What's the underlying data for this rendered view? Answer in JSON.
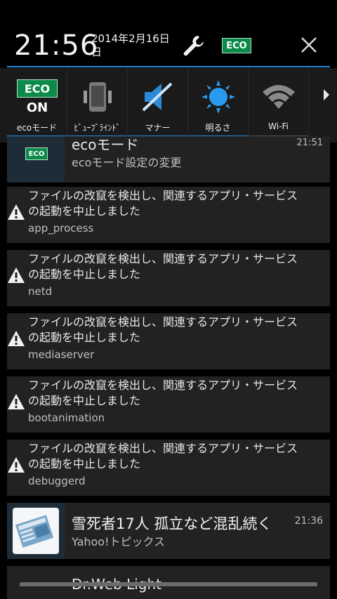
{
  "header": {
    "time": "21:56",
    "date_line1": "2014年2月16日",
    "date_line2": "日",
    "eco_badge": "ECO"
  },
  "quick_settings": [
    {
      "label": "ecoモード",
      "icon": "eco-on-icon",
      "state": "ON",
      "badge": "ECO",
      "bar": "#2a8ad8"
    },
    {
      "label": "ﾋﾞｭｰﾌﾞﾗｲﾝﾄﾞ",
      "icon": "view-blind-icon",
      "bar": "#2a8ad8"
    },
    {
      "label": "マナー",
      "icon": "manner-mode-icon",
      "bar": "#2a8ad8"
    },
    {
      "label": "明るさ",
      "icon": "brightness-icon",
      "bar": "#2a8ad8"
    },
    {
      "label": "Wi-Fi",
      "icon": "wifi-icon",
      "bar": "#555555"
    }
  ],
  "notifications": {
    "eco": {
      "title": "ecoモード",
      "subtitle": "ecoモード設定の変更",
      "time": "21:51",
      "badge": "ECO"
    },
    "alerts": [
      {
        "line1": "ファイルの改竄を検出し、関連するアプリ・サービス",
        "line2": "の起動を中止しました",
        "process": "app_process"
      },
      {
        "line1": "ファイルの改竄を検出し、関連するアプリ・サービス",
        "line2": "の起動を中止しました",
        "process": "netd"
      },
      {
        "line1": "ファイルの改竄を検出し、関連するアプリ・サービス",
        "line2": "の起動を中止しました",
        "process": "mediaserver"
      },
      {
        "line1": "ファイルの改竄を検出し、関連するアプリ・サービス",
        "line2": "の起動を中止しました",
        "process": "bootanimation"
      },
      {
        "line1": "ファイルの改竄を検出し、関連するアプリ・サービス",
        "line2": "の起動を中止しました",
        "process": "debuggerd"
      }
    ],
    "news": {
      "title": "雪死者17人 孤立など混乱続く",
      "subtitle": "Yahoo!トピックス",
      "time": "21:36"
    },
    "partial": {
      "title": "Dr.Web Light"
    }
  },
  "colors": {
    "accent": "#2a8ad8",
    "eco_green": "#0c8a4a",
    "brightness": "#2a9af0"
  }
}
